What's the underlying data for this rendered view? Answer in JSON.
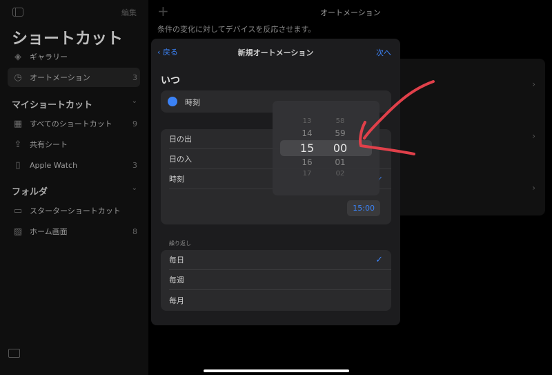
{
  "sidebar": {
    "edit": "編集",
    "title": "ショートカット",
    "top_items": [
      {
        "label": "ギャラリー",
        "icon": "layers-icon"
      },
      {
        "label": "オートメーション",
        "count": "3",
        "icon": "clock-icon"
      }
    ],
    "my_section": "マイショートカット",
    "my_items": [
      {
        "label": "すべてのショートカット",
        "count": "9"
      },
      {
        "label": "共有シート"
      },
      {
        "label": "Apple Watch",
        "count": "3"
      }
    ],
    "folder_section": "フォルダ",
    "folder_items": [
      {
        "label": "スターターショートカット"
      },
      {
        "label": "ホーム画面",
        "count": "8"
      }
    ]
  },
  "main": {
    "title": "オートメーション",
    "subtitle": "条件の変化に対してデバイスを反応させます。",
    "add": "+"
  },
  "modal": {
    "back": "戻る",
    "title": "新規オートメーション",
    "next": "次へ",
    "heading": "いつ",
    "trigger": "時刻",
    "time_options": [
      "日の出",
      "日の入",
      "時刻"
    ],
    "time_value": "15:00",
    "repeat_label": "繰り返し",
    "repeat_options": [
      "毎日",
      "毎週",
      "毎月"
    ],
    "repeat_selected": "毎日"
  },
  "picker": {
    "hours": [
      "13",
      "14",
      "15",
      "16",
      "17"
    ],
    "minutes": [
      "58",
      "59",
      "00",
      "01",
      "02"
    ],
    "selected_hour": "15",
    "selected_minute": "00"
  },
  "colors": {
    "accent": "#3b82f6",
    "annotation": "#e0404a"
  }
}
